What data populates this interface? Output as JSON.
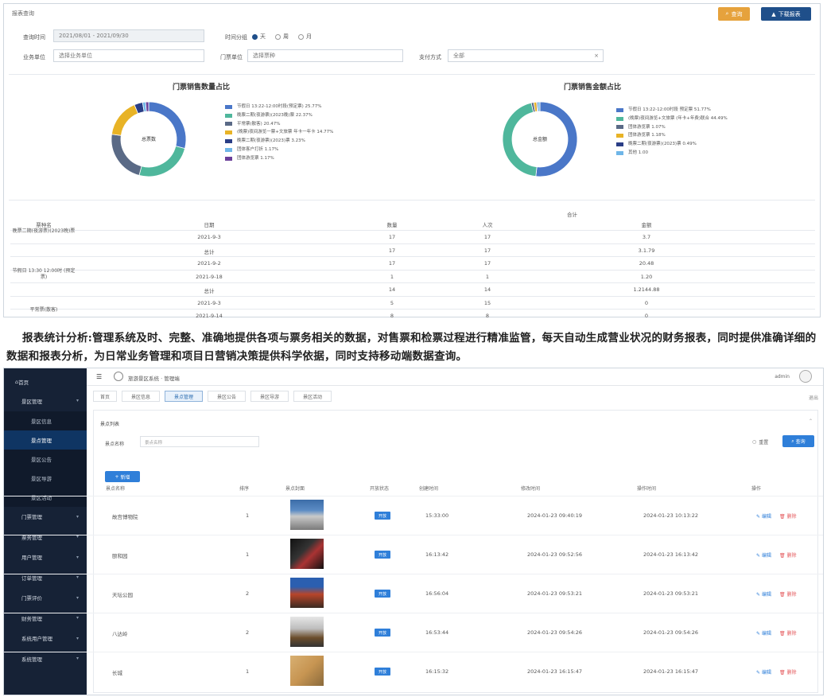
{
  "report": {
    "header": "报表查询",
    "query_btn": "查询",
    "export_btn": "下载报表",
    "form": {
      "date_label": "查询时间",
      "date_value": "2021/08/01 - 2021/09/30",
      "granularity_label": "时间分组",
      "granularity_options": [
        "天",
        "周",
        "月"
      ],
      "granularity_selected": "天",
      "venue_label": "业务单位",
      "venue_placeholder": "选择业务单位",
      "gate_label": "门票单位",
      "gate_placeholder": "选择票种",
      "payment_label": "支付方式",
      "payment_value": "全部"
    },
    "pie1": {
      "title": "门票销售数量占比",
      "center": "总票数",
      "legend": [
        {
          "label": "节假日 13:22-12:00时段(预定票) 25.77%",
          "color": "#4a77c8"
        },
        {
          "label": "晚票二期(夜游票)(2023晚)票 22.37%",
          "color": "#4fb79c"
        },
        {
          "label": "平常票(散客) 20.47%",
          "color": "#5a6a86"
        },
        {
          "label": "(晚票)夜间游览一票+文旅票 年卡一年卡 14.77%",
          "color": "#e8b326"
        },
        {
          "label": "晚票二期(夜游票)(2023)票 3.23%",
          "color": "#2a3e86"
        },
        {
          "label": "团体客户打折 1.17%",
          "color": "#6fb6e8"
        },
        {
          "label": "团体游览票 1.17%",
          "color": "#6a3f9a"
        }
      ]
    },
    "pie2": {
      "title": "门票销售金额占比",
      "center": "总金额",
      "legend": [
        {
          "label": "节假日 13:22-12:00时段 预定票 51.77%",
          "color": "#4a77c8"
        },
        {
          "label": "(晚票)夜间游览+文旅票 (年卡+年费)联合 44.49%",
          "color": "#4fb79c"
        },
        {
          "label": "团体游览票 1.07%",
          "color": "#5a6a86"
        },
        {
          "label": "团体游览票 1.18%",
          "color": "#e8b326"
        },
        {
          "label": "晚票二期(夜游票)(2023)票 0.49%",
          "color": "#2a3e86"
        },
        {
          "label": "其他 1.00",
          "color": "#6fb6e8"
        }
      ]
    },
    "chart_data": [
      {
        "type": "pie",
        "title": "门票销售数量占比",
        "categories": [
          "节假日 13:22-12:00时段(预定票)",
          "晚票二期(夜游票)(2023晚)票",
          "平常票(散客)",
          "(晚票)夜间游览一票+文旅票 年卡一年卡",
          "晚票二期(夜游票)(2023)票",
          "团体客户打折",
          "团体游览票"
        ],
        "values": [
          25.77,
          22.37,
          20.47,
          14.77,
          3.23,
          1.17,
          1.17
        ]
      },
      {
        "type": "pie",
        "title": "门票销售金额占比",
        "categories": [
          "节假日 13:22-12:00时段 预定票",
          "(晚票)夜间游览+文旅票 (年卡+年费)联合",
          "团体游览票",
          "团体游览票",
          "晚票二期(夜游票)(2023)票",
          "其他"
        ],
        "values": [
          51.77,
          44.49,
          1.07,
          1.18,
          0.49,
          1.0
        ]
      }
    ],
    "table": {
      "group_header": "合计",
      "headers": [
        "票种名",
        "日期",
        "数量",
        "人次",
        "金额"
      ],
      "rows": [
        {
          "name": "晚票二期(夜游票)(2023晚)票",
          "date": "2021-9-3",
          "qty": "17",
          "people": "17",
          "amount": "3.7"
        },
        {
          "name": "",
          "date": "总计",
          "qty": "17",
          "people": "17",
          "amount": "3.1.79"
        },
        {
          "name": "",
          "date": "2021-9-2",
          "qty": "17",
          "people": "17",
          "amount": "20.48"
        },
        {
          "name": "节假日 13:30 12:00时 (预定票)",
          "date": "2021-9-18",
          "qty": "1",
          "people": "1",
          "amount": "1.20"
        },
        {
          "name": "",
          "date": "总计",
          "qty": "14",
          "people": "14",
          "amount": "1.2144.88"
        },
        {
          "name": "",
          "date": "2021-9-3",
          "qty": "5",
          "people": "15",
          "amount": "0"
        },
        {
          "name": "平常票(散客)",
          "date": "2021-9-14",
          "qty": "8",
          "people": "8",
          "amount": "0"
        }
      ]
    }
  },
  "caption": {
    "title": "报表统计分析:",
    "body": "管理系统及时、完整、准确地提供各项与票务相关的数据，对售票和检票过程进行精准监管，每天自动生成营业状况的财务报表，同时提供准确详细的数据和报表分析，为日常业务管理和项目日营销决策提供科学依据，同时支持移动端数据查询。"
  },
  "app": {
    "sidebar": [
      {
        "label": "首页",
        "type": "top"
      },
      {
        "label": "景区管理",
        "type": "group"
      },
      {
        "label": "景区信息",
        "type": "sub"
      },
      {
        "label": "景点管理",
        "type": "sub",
        "active": true
      },
      {
        "label": "景区公告",
        "type": "sub"
      },
      {
        "label": "景区导游",
        "type": "sub"
      },
      {
        "label": "景区活动",
        "type": "sub"
      },
      {
        "label": "门票管理",
        "type": "group"
      },
      {
        "label": "票务管理",
        "type": "group"
      },
      {
        "label": "用户管理",
        "type": "group"
      },
      {
        "label": "订单管理",
        "type": "group"
      },
      {
        "label": "门票评价",
        "type": "group"
      },
      {
        "label": "财务管理",
        "type": "group"
      },
      {
        "label": "系统用户管理",
        "type": "group"
      },
      {
        "label": "系统管理",
        "type": "group"
      }
    ],
    "topbar": {
      "title": "旅游景区系统 · 管理端",
      "user": "admin",
      "logout": "退出"
    },
    "tabs": [
      "首页",
      "景区信息",
      "景点管理",
      "景区公告",
      "景区导游",
      "景区活动"
    ],
    "active_tab": 2,
    "search": {
      "section": "景点列表",
      "label": "景点名称",
      "placeholder": "景点名称",
      "reset": "重置",
      "query": "查询",
      "add": "新增"
    },
    "columns": [
      "景点名称",
      "排序",
      "景点封面",
      "开放状态",
      "创建时间",
      "修改时间",
      "操作时间",
      "操作"
    ],
    "rows": [
      {
        "name": "故宫博物院",
        "sort": "1",
        "status": "开放",
        "create": "15:33:00",
        "updated": "2024-01-23 09:40:19",
        "op": "2024-01-23 10:13:22",
        "img": "a"
      },
      {
        "name": "颐和园",
        "sort": "1",
        "status": "开放",
        "create": "16:13:42",
        "updated": "2024-01-23 09:52:56",
        "op": "2024-01-23 16:13:42",
        "img": "b"
      },
      {
        "name": "天坛公园",
        "sort": "2",
        "status": "开放",
        "create": "16:56:04",
        "updated": "2024-01-23 09:53:21",
        "op": "2024-01-23 09:53:21",
        "img": "c"
      },
      {
        "name": "八达岭",
        "sort": "2",
        "status": "开放",
        "create": "16:53:44",
        "updated": "2024-01-23 09:54:26",
        "op": "2024-01-23 09:54:26",
        "img": "d"
      },
      {
        "name": "长城",
        "sort": "1",
        "status": "开放",
        "create": "16:15:32",
        "updated": "2024-01-23 16:15:47",
        "op": "2024-01-23 16:15:47",
        "img": "e"
      }
    ],
    "edit": "编辑",
    "delete": "删除"
  }
}
